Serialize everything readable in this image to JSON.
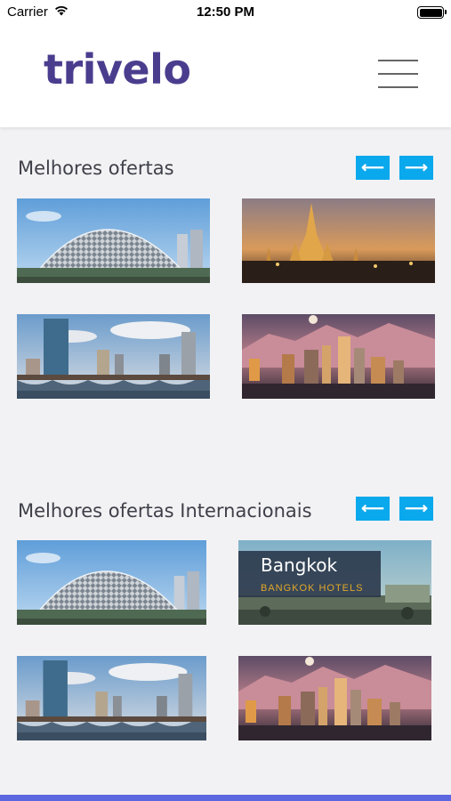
{
  "status_bar": {
    "carrier": "Carrier",
    "time": "12:50 PM"
  },
  "header": {
    "logo_text": "trivelo",
    "brand_color": "#4a3d8e"
  },
  "sections": [
    {
      "title": "Melhores ofertas",
      "prev_label": "⟵",
      "next_label": "⟶",
      "tiles": [
        {
          "scene": "singapore-esplanade"
        },
        {
          "scene": "bangkok-temple"
        },
        {
          "scene": "boston-skyline"
        },
        {
          "scene": "los-angeles-skyline"
        }
      ]
    },
    {
      "title": "Melhores ofertas Internacionais",
      "prev_label": "⟵",
      "next_label": "⟶",
      "tiles": [
        {
          "scene": "singapore-esplanade"
        },
        {
          "scene": "bangkok-hotels",
          "overlay_title": "Bangkok",
          "overlay_subtitle": "BANGKOK HOTELS"
        },
        {
          "scene": "boston-skyline"
        },
        {
          "scene": "los-angeles-skyline"
        }
      ]
    }
  ],
  "colors": {
    "accent": "#0aa8ec",
    "bottom_bar": "#5c67e0"
  }
}
